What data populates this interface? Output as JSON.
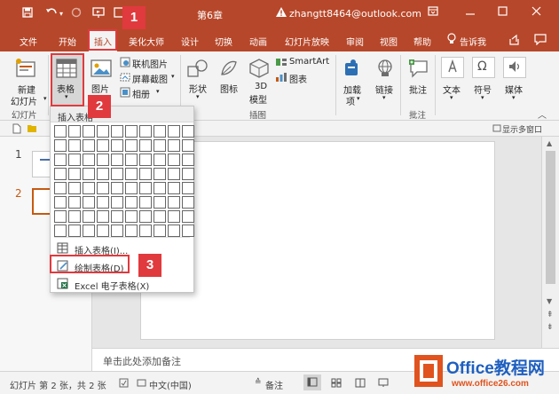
{
  "window": {
    "title": "第6章",
    "account": "zhangtt8464@outlook.com"
  },
  "tabs": [
    "文件",
    "开始",
    "插入",
    "美化大师",
    "设计",
    "切换",
    "动画",
    "幻灯片放映",
    "审阅",
    "视图",
    "帮助",
    "告诉我"
  ],
  "ribbon": {
    "new_slide": "新建",
    "new_slide2": "幻灯片",
    "table": "表格",
    "image": "图片",
    "online_image": "联机图片",
    "screenshot": "屏幕截图",
    "album": "相册",
    "shapes": "形状",
    "icons": "图标",
    "model3d": "3D",
    "model3d2": "模型",
    "smartart": "SmartArt",
    "chart": "图表",
    "addins": "加载",
    "addins2": "项",
    "link": "链接",
    "comment": "批注",
    "text": "文本",
    "symbol": "符号",
    "media": "媒体",
    "group_slides": "幻灯片",
    "group_illus": "插图",
    "group_comment": "批注",
    "show_multi": "显示多窗口"
  },
  "dropdown": {
    "header": "插入表格",
    "item_insert": "插入表格(I)...",
    "item_draw": "绘制表格(D)",
    "item_excel": "Excel 电子表格(X)"
  },
  "slides": {
    "num1": "1",
    "num2": "2"
  },
  "notes_placeholder": "单击此处添加备注",
  "status": {
    "slide_info": "幻灯片 第 2 张，共 2 张",
    "language": "中文(中国)",
    "notes": "备注"
  },
  "annotations": [
    "1",
    "2",
    "3"
  ],
  "watermark": {
    "brand": "Office教程网",
    "url": "www.office26.com"
  },
  "colors": {
    "accent": "#b7472a",
    "annotation_red": "#e03a3e"
  }
}
